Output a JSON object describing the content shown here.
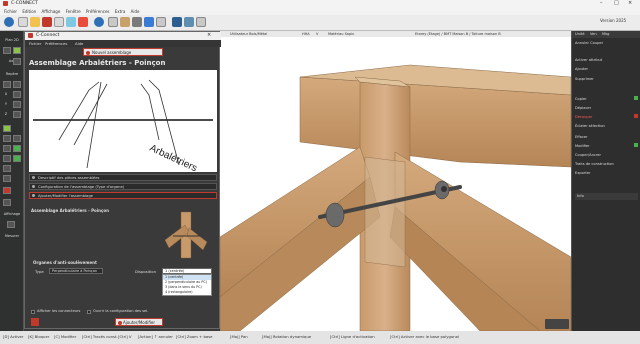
{
  "app": {
    "title": "C-CONNECT",
    "version": "Version 2025"
  },
  "menu": [
    "Fichier",
    "Edition",
    "Affichage",
    "Fenêtre",
    "Préférences",
    "Extra",
    "Aide"
  ],
  "left_panel": {
    "items": [
      "Plan 2D",
      "Axe",
      "Repère",
      "Affichage",
      "Mesurer"
    ],
    "labels": [
      "X",
      "Y",
      "Z"
    ]
  },
  "viewport_header": {
    "left": "Utilisateur Bois/Métal",
    "mid1": "HHA",
    "mid2": "V",
    "mid3": "Matériau Sapin",
    "right": "Etorey (Etage) / BMT Maison B / Toiture maison B"
  },
  "right_panel": {
    "tabs": [
      "Unité",
      "Ven",
      "Mkg"
    ],
    "items": [
      "Annuler Couper",
      "Activer attribut",
      "Ajouter",
      "Supprimer",
      "Copier",
      "Déplacer",
      "Découper",
      "Éclater sélection",
      "Effacer",
      "Modifier",
      "Couper/Ancrer",
      "Traits de construction",
      "Exporter"
    ],
    "info": "Info"
  },
  "dialog": {
    "title": "C-Connect",
    "menu": [
      "Fichier",
      "Préférences",
      "Aide"
    ],
    "tab_active": "Nouvel assemblage",
    "heading": "Assemblage Arbalétriers - Poinçon",
    "diagram_label": "Arbalétriers",
    "sections": [
      "Descriptif des pièces assemblées",
      "Configuration de l'assemblage (Type d'organe)",
      "Ajouter/Modifier l'assemblage"
    ],
    "sub_heading": "Assemblage Arbalétriers - Poinçon",
    "organs_title": "Organes d'anti-soulèvement",
    "type_label": "Type",
    "type_value": "Perpendiculaire à Poinçon",
    "disposition_label": "Disposition",
    "disposition_value": "1 (centrée)",
    "disposition_options": [
      "1 (centrée)",
      "2 (perpendiculaire au PC)",
      "3 (dans le sens du PC)",
      "4 (rectangulaire)"
    ],
    "check1": "Afficher les connecteurs",
    "check2": "Ouvrir la configuration des sel.",
    "action_button": "Ajouter/Modifier"
  },
  "statusbar": {
    "items": [
      "[D] Activer",
      "[K] Bloquer",
      "[C] Modifier",
      "[Ctrl] Tracés const.",
      "[Ctrl] V",
      "[Action] ↑ annuler",
      "[Ctrl] Zoom + base",
      "[Maj] Pan",
      "[Maj] Rotation dynamique",
      "[Ctrl] Ligne d'activation",
      "[Ctrl] Activer avec le base polygonal"
    ]
  },
  "colors": {
    "accent": "#c0392b",
    "highlight": "#ff4444",
    "wood": "#c89a6a"
  }
}
